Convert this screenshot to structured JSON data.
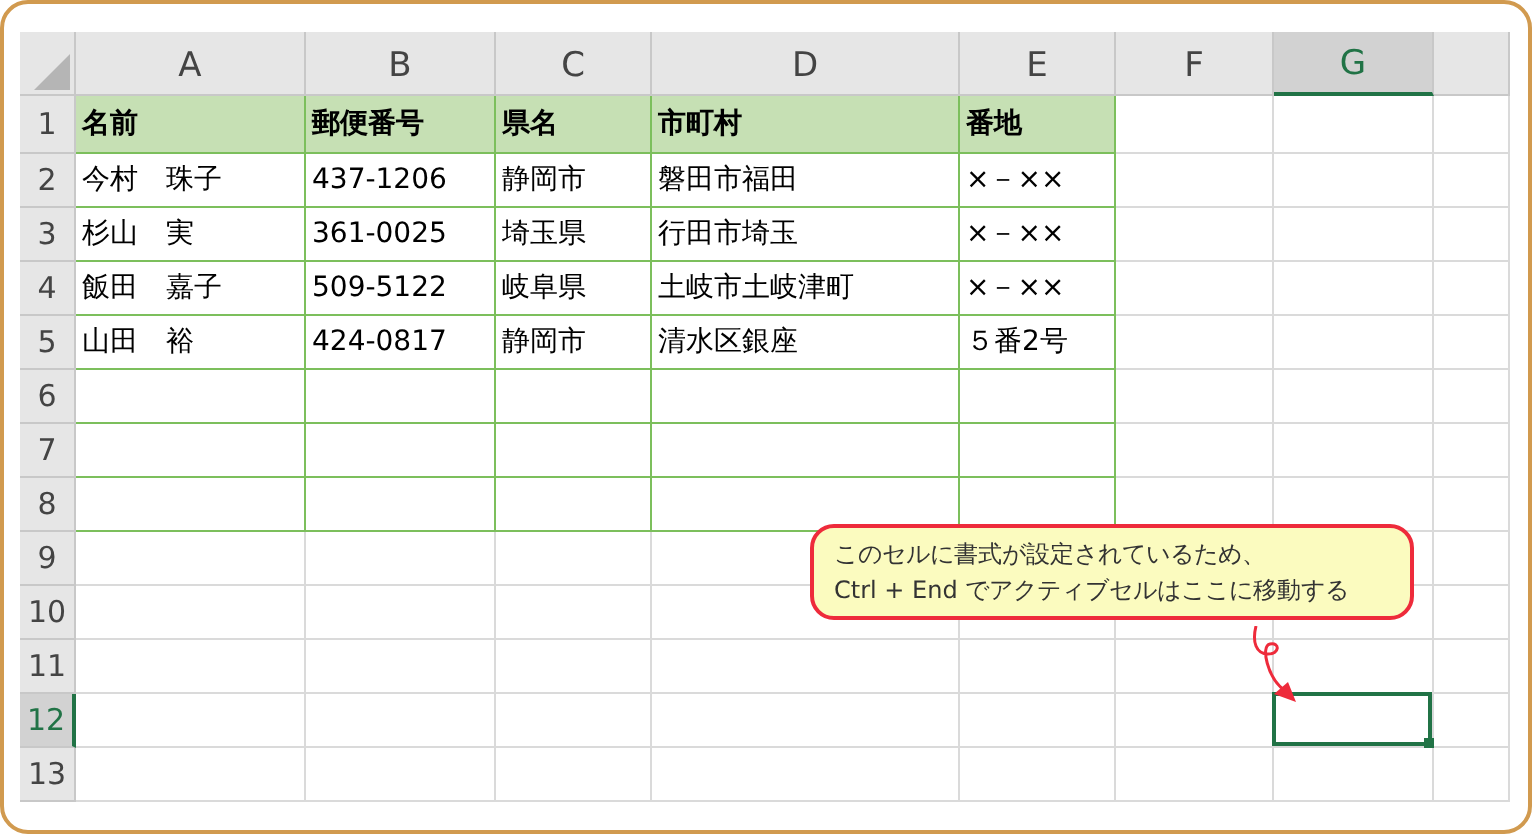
{
  "sheet": {
    "columns": [
      {
        "label": "A",
        "selected": false,
        "formatted": true
      },
      {
        "label": "B",
        "selected": false,
        "formatted": true
      },
      {
        "label": "C",
        "selected": false,
        "formatted": true
      },
      {
        "label": "D",
        "selected": false,
        "formatted": true
      },
      {
        "label": "E",
        "selected": false,
        "formatted": true
      },
      {
        "label": "F",
        "selected": false,
        "formatted": false
      },
      {
        "label": "G",
        "selected": true,
        "formatted": false
      },
      {
        "selected": false,
        "formatted": false
      }
    ],
    "rows": [
      {
        "label": "1",
        "selected": false,
        "kind": "header",
        "cells": [
          "名前",
          "郵便番号",
          "県名",
          "市町村",
          "番地"
        ]
      },
      {
        "label": "2",
        "selected": false,
        "kind": "data",
        "cells": [
          "今村　珠子",
          "437-1206",
          "静岡市",
          "磐田市福田",
          "×－××"
        ]
      },
      {
        "label": "3",
        "selected": false,
        "kind": "data",
        "cells": [
          "杉山　実",
          "361-0025",
          "埼玉県",
          "行田市埼玉",
          "×－××"
        ]
      },
      {
        "label": "4",
        "selected": false,
        "kind": "data",
        "cells": [
          "飯田　嘉子",
          "509-5122",
          "岐阜県",
          "土岐市土岐津町",
          "×－××"
        ]
      },
      {
        "label": "5",
        "selected": false,
        "kind": "data",
        "cells": [
          "山田　裕",
          "424-0817",
          "静岡市",
          "清水区銀座",
          "５番2号"
        ]
      },
      {
        "label": "6",
        "selected": false,
        "kind": "data"
      },
      {
        "label": "7",
        "selected": false,
        "kind": "data"
      },
      {
        "label": "8",
        "selected": false,
        "kind": "data"
      },
      {
        "label": "9",
        "selected": false,
        "kind": "plain"
      },
      {
        "label": "10",
        "selected": false,
        "kind": "plain"
      },
      {
        "label": "11",
        "selected": false,
        "kind": "plain"
      },
      {
        "label": "12",
        "selected": true,
        "kind": "plain"
      },
      {
        "label": "13",
        "selected": false,
        "kind": "plain"
      }
    ]
  },
  "callout": {
    "lines": [
      "このセルに書式が設定されているため、",
      "Ctrl + End でアクティブセルはここに移動する"
    ]
  }
}
